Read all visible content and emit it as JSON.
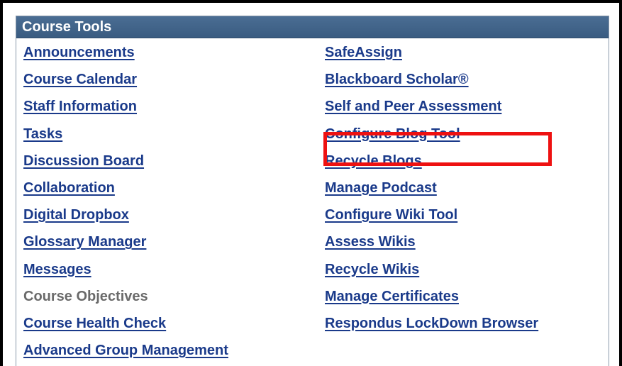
{
  "panel": {
    "title": "Course Tools"
  },
  "left_column": [
    {
      "label": "Announcements",
      "enabled": true
    },
    {
      "label": "Course Calendar",
      "enabled": true
    },
    {
      "label": "Staff Information",
      "enabled": true
    },
    {
      "label": "Tasks",
      "enabled": true
    },
    {
      "label": "Discussion Board",
      "enabled": true
    },
    {
      "label": "Collaboration",
      "enabled": true
    },
    {
      "label": "Digital Dropbox",
      "enabled": true
    },
    {
      "label": "Glossary Manager",
      "enabled": true
    },
    {
      "label": "Messages",
      "enabled": true
    },
    {
      "label": "Course Objectives",
      "enabled": false
    },
    {
      "label": "Course Health Check",
      "enabled": true
    },
    {
      "label": "Advanced Group Management",
      "enabled": true
    }
  ],
  "right_column": [
    {
      "label": "SafeAssign",
      "enabled": true
    },
    {
      "label": "Blackboard Scholar®",
      "enabled": true
    },
    {
      "label": "Self and Peer Assessment",
      "enabled": true
    },
    {
      "label": "Configure Blog Tool",
      "enabled": true,
      "highlighted": true
    },
    {
      "label": "Recycle Blogs",
      "enabled": true
    },
    {
      "label": "Manage Podcast",
      "enabled": true
    },
    {
      "label": "Configure Wiki Tool",
      "enabled": true
    },
    {
      "label": "Assess Wikis",
      "enabled": true
    },
    {
      "label": "Recycle Wikis",
      "enabled": true
    },
    {
      "label": "Manage Certificates",
      "enabled": true
    },
    {
      "label": "Respondus LockDown Browser",
      "enabled": true
    }
  ],
  "colors": {
    "header_bg": "#3f6289",
    "link": "#1a3a8a",
    "disabled_text": "#6a6a6a",
    "highlight": "#ee1111"
  }
}
